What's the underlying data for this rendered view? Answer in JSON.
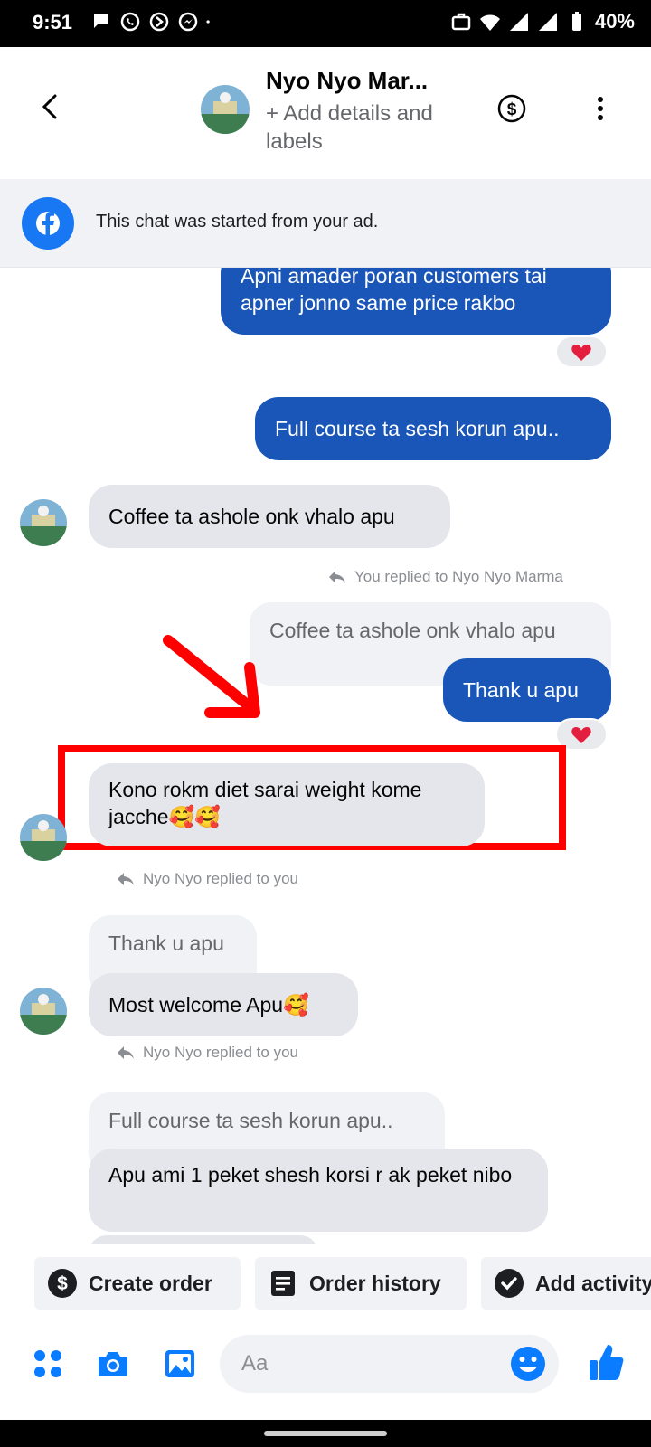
{
  "status_bar": {
    "time": "9:51",
    "battery": "40%"
  },
  "header": {
    "name": "Nyo Nyo Mar...",
    "subtitle": "+ Add details and labels"
  },
  "ad_banner": {
    "text": "This chat was started from your ad."
  },
  "messages": {
    "m1": "Apni amader poran customers tai apner jonno same price rakbo",
    "m2": "Full course ta sesh korun apu..",
    "m3": "Coffee ta ashole onk vhalo apu",
    "m4_meta": "You replied to Nyo Nyo Marma",
    "m4_quote": "Coffee ta ashole onk vhalo apu",
    "m4": "Thank u apu",
    "m5": "Kono rokm diet sarai weight kome jacche🥰🥰",
    "m6_meta": "Nyo Nyo replied to you",
    "m6_quote": "Thank u apu",
    "m6": "Most welcome Apu🥰",
    "m7_meta": "Nyo Nyo replied to you",
    "m7_quote": "Full course ta sesh korun apu..",
    "m7": "Apu ami 1 peket shesh korsi r ak peket nibo"
  },
  "actions": {
    "create_order": "Create order",
    "order_history": "Order history",
    "add_activity": "Add activity"
  },
  "composer": {
    "placeholder": "Aa"
  },
  "colors": {
    "messenger_blue": "#1a56b8",
    "incoming_gray": "#e4e6eb",
    "highlight_red": "#ff0000"
  }
}
